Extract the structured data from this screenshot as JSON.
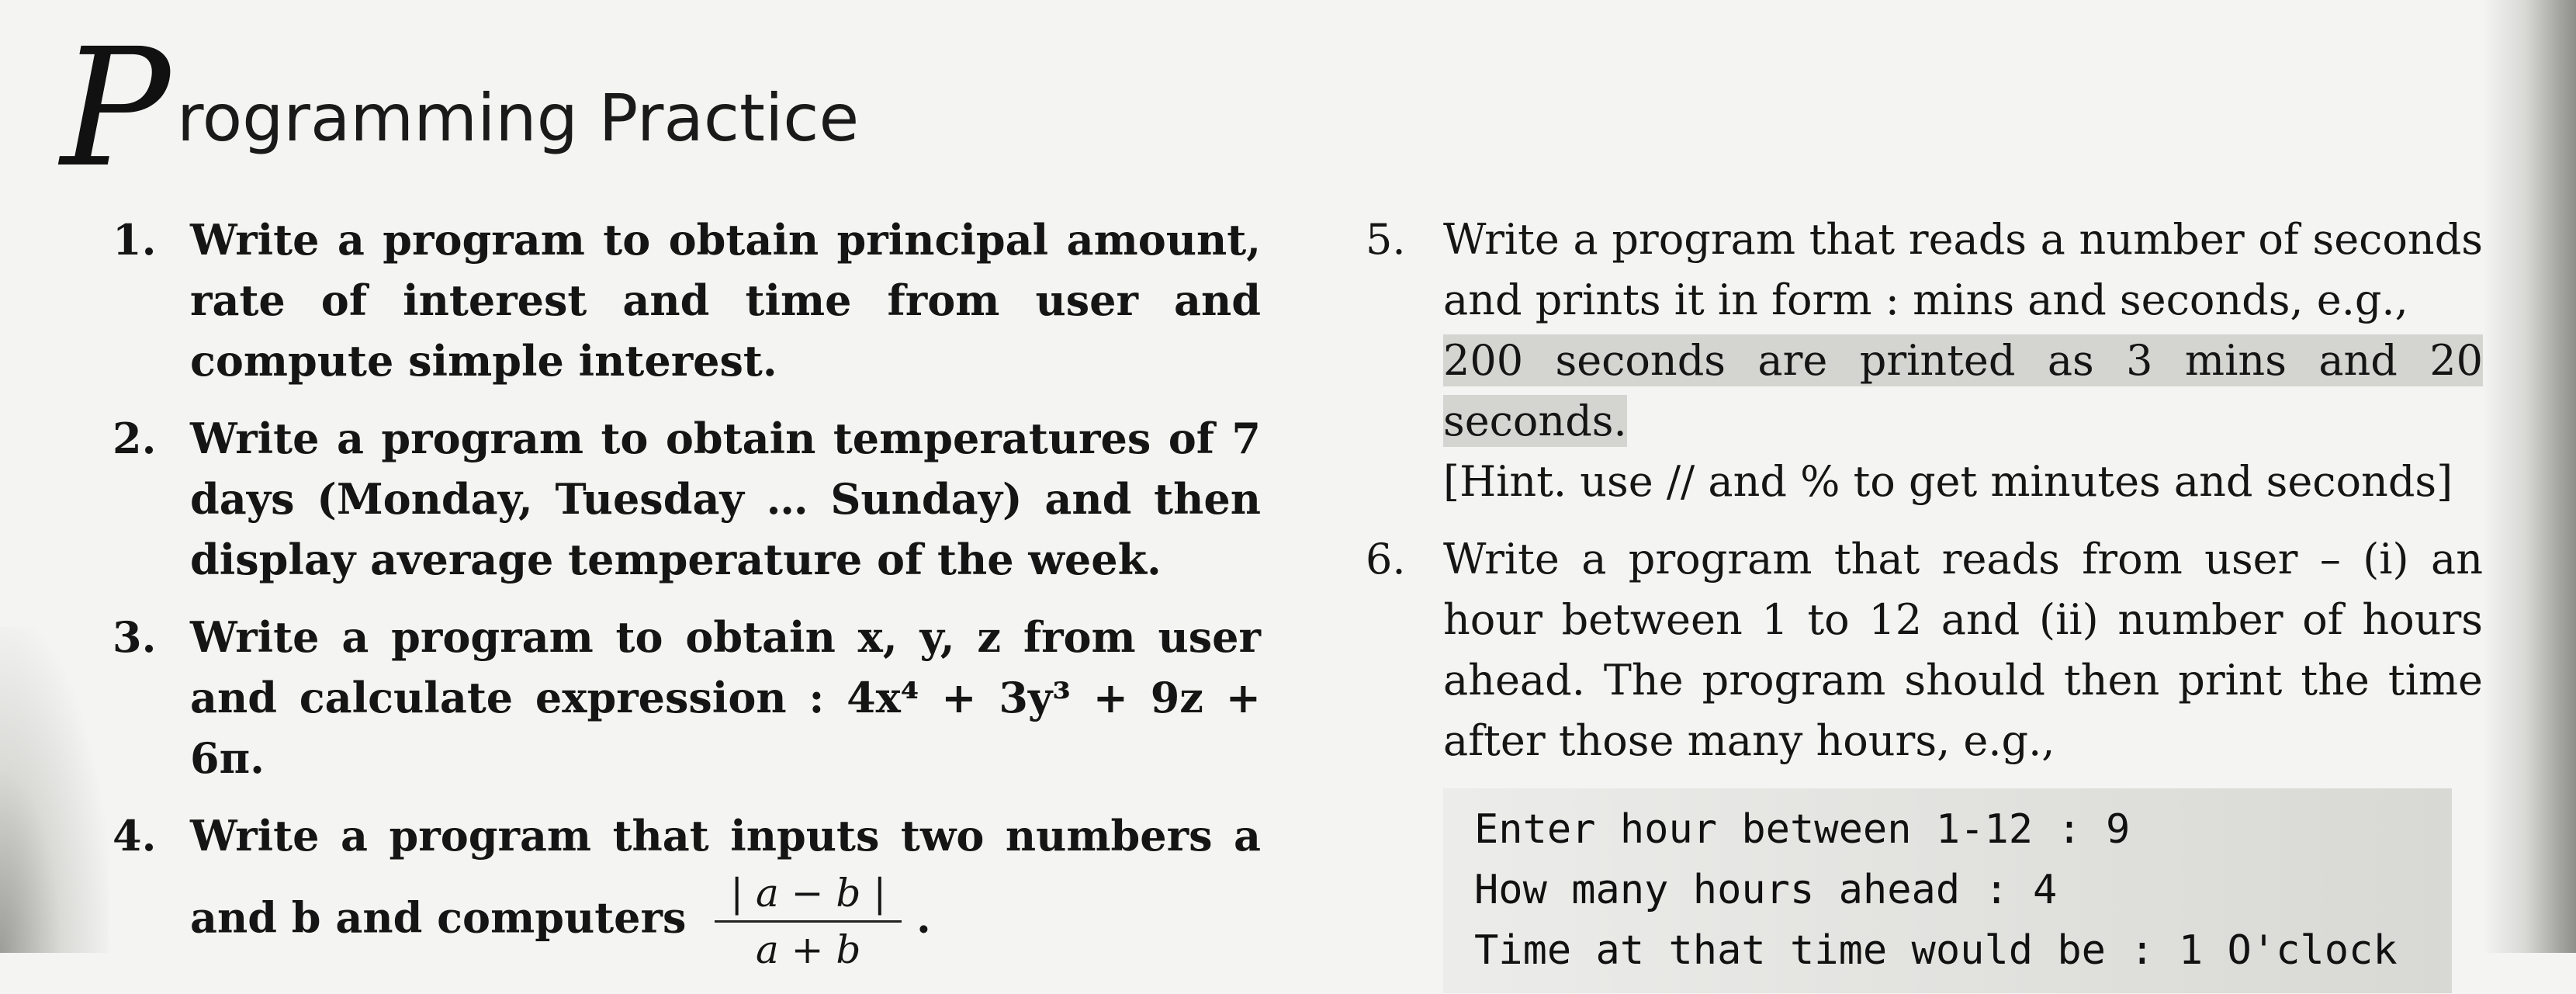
{
  "title": {
    "initial": "P",
    "rest": "rogramming Practice"
  },
  "questions_left": [
    {
      "number": "1.",
      "text": "Write a program to obtain principal amount, rate of interest and time from user and compute simple interest."
    },
    {
      "number": "2.",
      "text": "Write a program to obtain temperatures of 7 days (Monday, Tuesday … Sunday) and then display average temperature of the week."
    },
    {
      "number": "3.",
      "text": "Write a program to obtain x, y, z from user and calculate expression : 4x⁴ + 3y³ + 9z + 6π."
    },
    {
      "number": "4.",
      "text_a": "Write a program that inputs two numbers a and b and computers",
      "frac_num": "| a − b |",
      "frac_den": "a + b",
      "text_end": "."
    }
  ],
  "questions_right": [
    {
      "number": "5.",
      "text_a": "Write a program that reads a number of seconds and prints it in form : mins and seconds, e.g.,",
      "text_b": "200 seconds are printed as 3 mins and 20 seconds.",
      "text_c": "[Hint. use // and % to get minutes and seconds]"
    },
    {
      "number": "6.",
      "text": "Write a program that reads from user – (i) an hour between 1 to 12 and (ii) number of hours ahead. The program should then print the time after those many hours, e.g.,"
    }
  ],
  "code_sample": [
    "Enter hour between 1-12 : 9",
    "How many hours ahead : 4",
    "Time at that time would be : 1 O'clock"
  ]
}
